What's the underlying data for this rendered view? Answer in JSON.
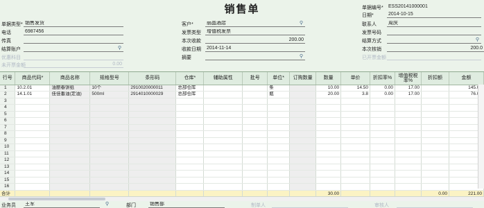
{
  "header": {
    "title": "销售单",
    "bill_no_label": "单据编号*",
    "bill_no": "ESS20141000001",
    "date_label": "日期*",
    "date": "2014-10-15"
  },
  "form": {
    "bill_type_label": "单据类型*",
    "bill_type": "销售发货",
    "customer_label": "客户*",
    "customer": "丽晶酒店",
    "contact_label": "联系人",
    "contact": "周庆",
    "phone_label": "电话",
    "phone": "6987456",
    "invoice_type_label": "发票类型",
    "invoice_type": "增值税发票",
    "invoice_no_label": "发票号码",
    "invoice_no": "",
    "fax_label": "传真",
    "fax": "",
    "receive_now_label": "本次收款",
    "receive_now": "200.00",
    "settle_method_label": "结算方式",
    "settle_method": "",
    "settle_account_label": "结算账户",
    "settle_account": "",
    "receive_date_label": "收款日期",
    "receive_date": "2014-11-14",
    "write_off_label": "本次核销",
    "write_off": "200.0",
    "pay_subject_label": "优惠科目",
    "pay_subject": "",
    "summary_label": "摘要",
    "summary": "",
    "invoiced_label": "已开票金额",
    "invoiced": "",
    "uninvoiced_label": "未开票金额",
    "uninvoiced": "0.00"
  },
  "table": {
    "columns": [
      "行号",
      "商品代码*",
      "商品名称",
      "规格型号",
      "条形码",
      "仓库*",
      "辅助属性",
      "批号",
      "单位*",
      "订购数量",
      "数量",
      "单价",
      "折扣率%",
      "增值税税率%",
      "折扣额",
      "金额"
    ],
    "rows": [
      {
        "no": "1",
        "code": "10.2.01",
        "name": "油丽春饼纸",
        "spec": "10个",
        "barcode": "2910020000011",
        "warehouse": "总部仓库",
        "aux": "",
        "batch": "",
        "unit": "条",
        "order_qty": "",
        "qty": "10.00",
        "price": "14.50",
        "discount_rate": "0.00",
        "tax_rate": "17.00",
        "discount": "",
        "amount": "145.00"
      },
      {
        "no": "2",
        "code": "14.1.01",
        "name": "佳佳番油(定油)",
        "spec": "500ml",
        "barcode": "2914010000029",
        "warehouse": "总部仓库",
        "aux": "",
        "batch": "",
        "unit": "瓶",
        "order_qty": "",
        "qty": "20.00",
        "price": "3.8",
        "discount_rate": "0.00",
        "tax_rate": "17.00",
        "discount": "",
        "amount": "76.00"
      }
    ],
    "empty_rows": [
      "3",
      "4",
      "5",
      "6",
      "7",
      "8",
      "9",
      "10",
      "11",
      "12",
      "13",
      "14",
      "15",
      "16"
    ],
    "total": {
      "label": "合计",
      "qty": "30.00",
      "discount": "0.00",
      "amount": "221.00"
    }
  },
  "footer": {
    "salesman_label": "业务员",
    "salesman": "王军",
    "dept_label": "部门",
    "dept": "销售部",
    "maker_label": "制单人",
    "checker_label": "审核人"
  },
  "icons": {
    "lookup": "magnifier-lookup-icon"
  }
}
